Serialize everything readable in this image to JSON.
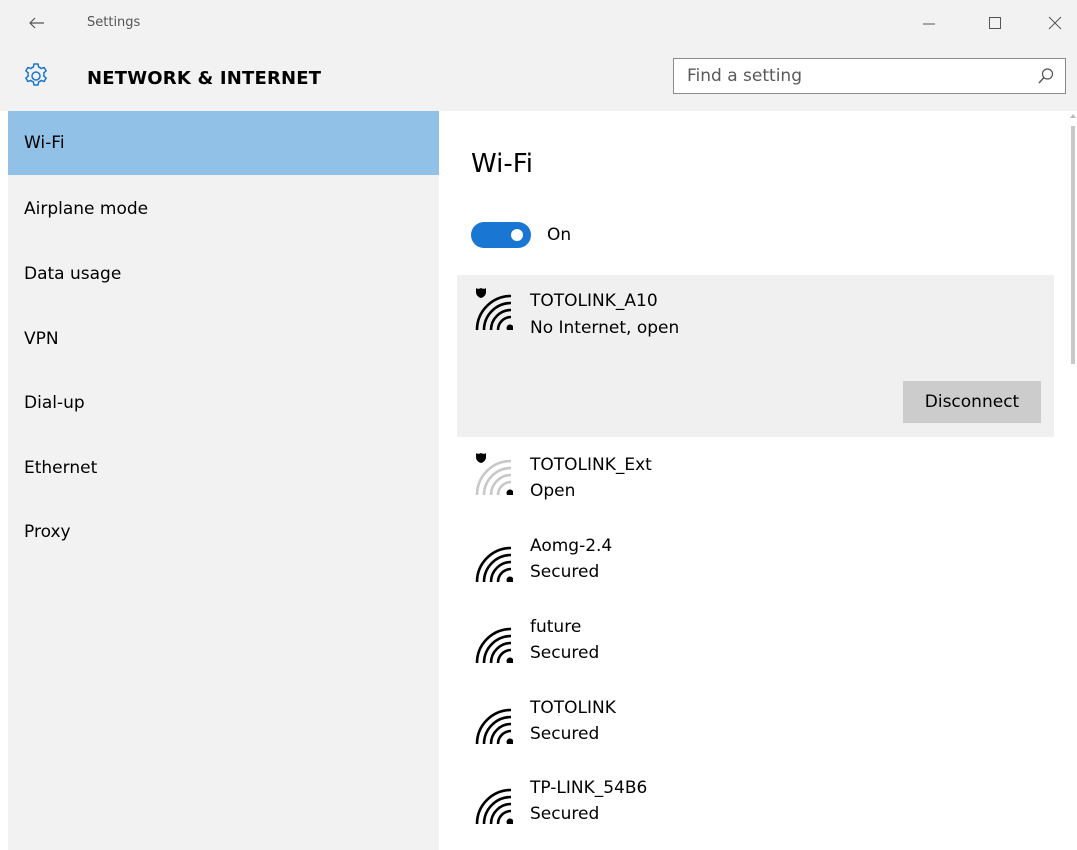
{
  "window": {
    "title": "Settings",
    "controls": [
      "minimize",
      "maximize",
      "close"
    ]
  },
  "header": {
    "section_title": "NETWORK & INTERNET",
    "search_placeholder": "Find a setting"
  },
  "sidebar": {
    "items": [
      {
        "label": "Wi-Fi",
        "selected": true
      },
      {
        "label": "Airplane mode",
        "selected": false
      },
      {
        "label": "Data usage",
        "selected": false
      },
      {
        "label": "VPN",
        "selected": false
      },
      {
        "label": "Dial-up",
        "selected": false
      },
      {
        "label": "Ethernet",
        "selected": false
      },
      {
        "label": "Proxy",
        "selected": false
      }
    ]
  },
  "main": {
    "title": "Wi-Fi",
    "toggle": {
      "state": "On",
      "on": true
    },
    "networks": [
      {
        "name": "TOTOLINK_A10",
        "status": "No Internet, open",
        "shield": true,
        "signal": "full",
        "expanded": true,
        "action": "Disconnect"
      },
      {
        "name": "TOTOLINK_Ext",
        "status": "Open",
        "shield": true,
        "signal": "weak",
        "expanded": false
      },
      {
        "name": "Aomg-2.4",
        "status": "Secured",
        "shield": false,
        "signal": "full",
        "expanded": false
      },
      {
        "name": "future",
        "status": "Secured",
        "shield": false,
        "signal": "full",
        "expanded": false
      },
      {
        "name": "TOTOLINK",
        "status": "Secured",
        "shield": false,
        "signal": "full",
        "expanded": false
      },
      {
        "name": "TP-LINK_54B6",
        "status": "Secured",
        "shield": false,
        "signal": "full",
        "expanded": false
      }
    ]
  },
  "colors": {
    "accent": "#1976d2",
    "selected_nav": "#91c1e6",
    "chrome_bg": "#f2f2f2",
    "button_bg": "#cccccc"
  }
}
